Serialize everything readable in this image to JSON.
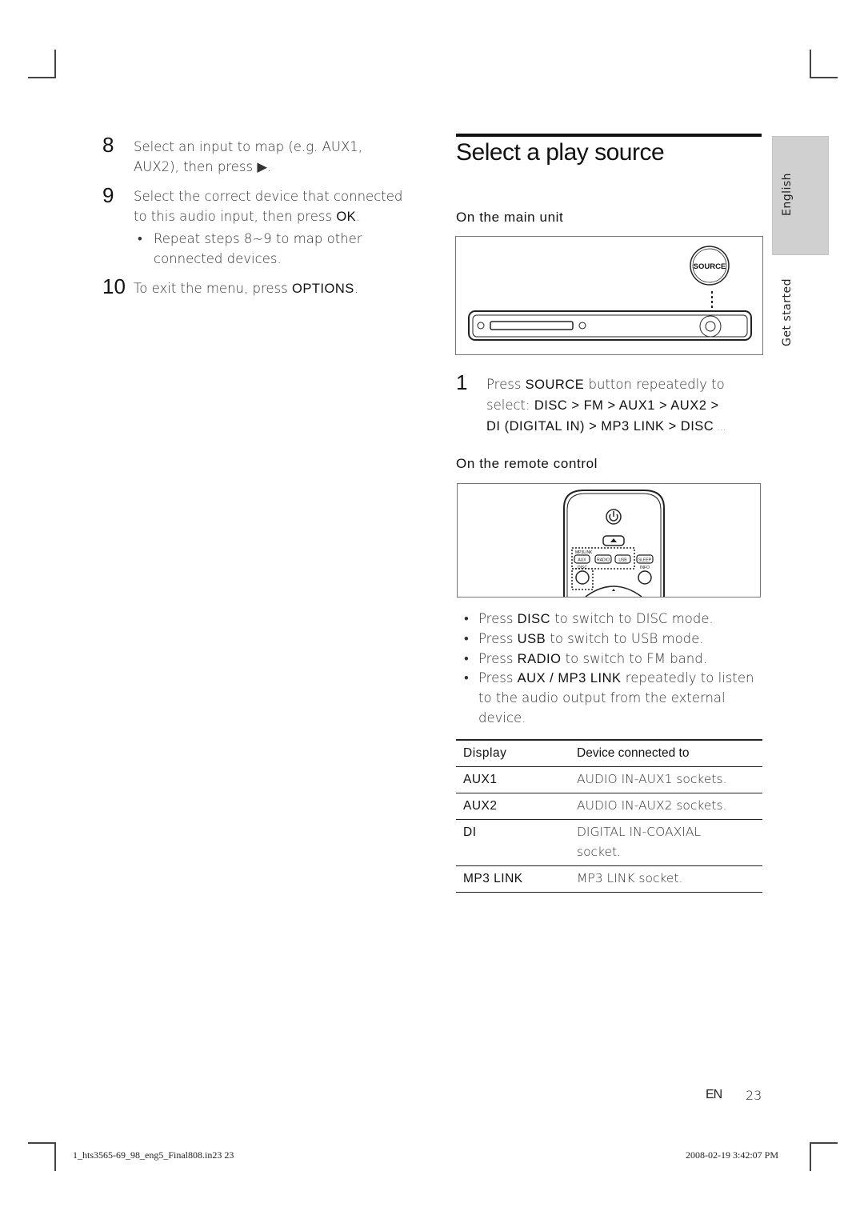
{
  "left_column": {
    "steps": [
      {
        "num": "8",
        "parts": [
          "Select an input to map (e.g. AUX1,",
          "AUX2), then press ▶."
        ]
      },
      {
        "num": "9",
        "line1": "Select the correct device that connected",
        "line2_pre": "to this audio input, then press ",
        "line2_kw": "OK",
        "line2_post": ".",
        "bullet": [
          "Repeat steps 8~9 to map other",
          "connected devices."
        ]
      },
      {
        "num": "10",
        "pre": "To exit the menu, press ",
        "kw": "OPTIONS",
        "post": "."
      }
    ]
  },
  "section": {
    "title": "Select a play source",
    "main_unit_heading": "On the main unit",
    "main_unit_figure": {
      "button_label": "SOURCE"
    },
    "step1": {
      "num": "1",
      "line1_pre": "Press ",
      "line1_kw": "SOURCE",
      "line1_post": " button repeatedly to",
      "line2_pre": "select: ",
      "line2_kw": "DISC > FM > AUX1 > AUX2 >",
      "line3_kw": "DI (DIGITAL IN) > MP3 LINK > DISC",
      "line3_post": " ..."
    },
    "remote_heading": "On the remote control",
    "remote_figure": {
      "labels": {
        "mp3link": "MP3LINK",
        "aux": "AUX",
        "radio": "RADIO",
        "usb": "USB",
        "sleep": "SLEEP",
        "disc": "DISC",
        "info": "INFO"
      }
    },
    "bullets": [
      {
        "pre": "Press ",
        "kw": "DISC",
        "post": " to switch to DISC mode."
      },
      {
        "pre": "Press ",
        "kw": "USB",
        "post": " to switch to USB mode."
      },
      {
        "pre": "Press ",
        "kw": "RADIO",
        "post": " to switch to FM band."
      },
      {
        "pre": "Press ",
        "kw": "AUX / MP3 LINK",
        "post": " repeatedly to listen to the audio output from the external device."
      }
    ],
    "table": {
      "headers": [
        "Display",
        "Device connected to"
      ],
      "rows": [
        [
          "AUX1",
          "AUDIO IN-AUX1 sockets."
        ],
        [
          "AUX2",
          "AUDIO IN-AUX2 sockets."
        ],
        [
          "DI",
          "DIGITAL IN-COAXIAL socket."
        ],
        [
          "MP3 LINK",
          "MP3 LINK socket."
        ]
      ]
    }
  },
  "side_tabs": {
    "language": "English",
    "chapter": "Get started"
  },
  "footer": {
    "lang": "EN",
    "page": "23"
  },
  "slug": {
    "file": "1_hts3565-69_98_eng5_Final808.in23   23",
    "timestamp": "2008-02-19   3:42:07 PM"
  }
}
